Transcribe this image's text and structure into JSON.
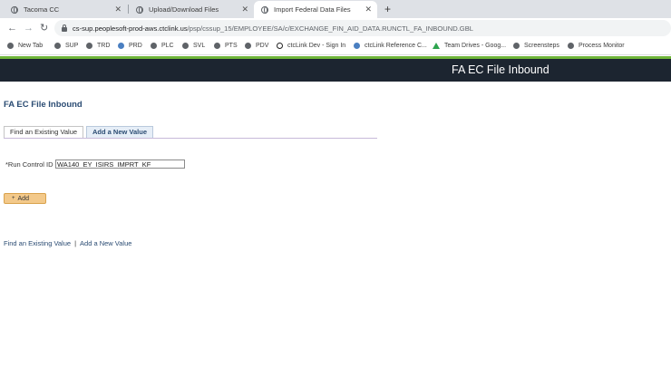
{
  "browser": {
    "tabs": [
      {
        "title": "Tacoma CC",
        "close": "✕",
        "icon": "globe-icon",
        "active": false
      },
      {
        "title": "Upload/Download Files",
        "close": "✕",
        "icon": "globe-icon",
        "active": false
      },
      {
        "title": "Import Federal Data Files",
        "close": "✕",
        "icon": "globe-icon",
        "active": true
      }
    ],
    "new_tab": "+",
    "nav": {
      "back": "←",
      "forward": "→",
      "reload": "↻"
    },
    "url_host": "cs-sup.peoplesoft-prod-aws.ctclink.us",
    "url_path": "/psp/cssup_15/EMPLOYEE/SA/c/EXCHANGE_FIN_AID_DATA.RUNCTL_FA_INBOUND.GBL",
    "bookmarks": [
      {
        "label": "New Tab",
        "icon": "globe-icon"
      },
      {
        "label": "SUP",
        "icon": "globe-icon"
      },
      {
        "label": "TRD",
        "icon": "globe-icon"
      },
      {
        "label": "PRD",
        "icon": "ctclink-icon"
      },
      {
        "label": "PLC",
        "icon": "globe-icon"
      },
      {
        "label": "SVL",
        "icon": "globe-icon"
      },
      {
        "label": "PTS",
        "icon": "globe-icon"
      },
      {
        "label": "PDV",
        "icon": "globe-icon"
      },
      {
        "label": "ctcLink Dev - Sign In",
        "icon": "ring-icon"
      },
      {
        "label": "ctcLink Reference C...",
        "icon": "ctclink-icon"
      },
      {
        "label": "Team Drives - Goog...",
        "icon": "drive-icon"
      },
      {
        "label": "Screensteps",
        "icon": "globe-icon"
      },
      {
        "label": "Process Monitor",
        "icon": "globe-icon"
      }
    ]
  },
  "header": {
    "title": "FA EC File Inbound"
  },
  "page": {
    "heading": "FA EC File Inbound",
    "tabs": {
      "find": "Find an Existing Value",
      "add": "Add a New Value"
    },
    "run_control": {
      "label": "*Run Control ID",
      "value": "WA140_EY_ISIRS_IMPRT_KF"
    },
    "add_button": {
      "icon": "+",
      "label": "Add"
    },
    "links": {
      "find": "Find an Existing Value",
      "separator": "|",
      "add": "Add a New Value"
    }
  },
  "colors": {
    "header_band": "#1c2530",
    "accent_line": "#6fb53a",
    "link": "#2b4c73",
    "add_button": "#f3c98a"
  }
}
